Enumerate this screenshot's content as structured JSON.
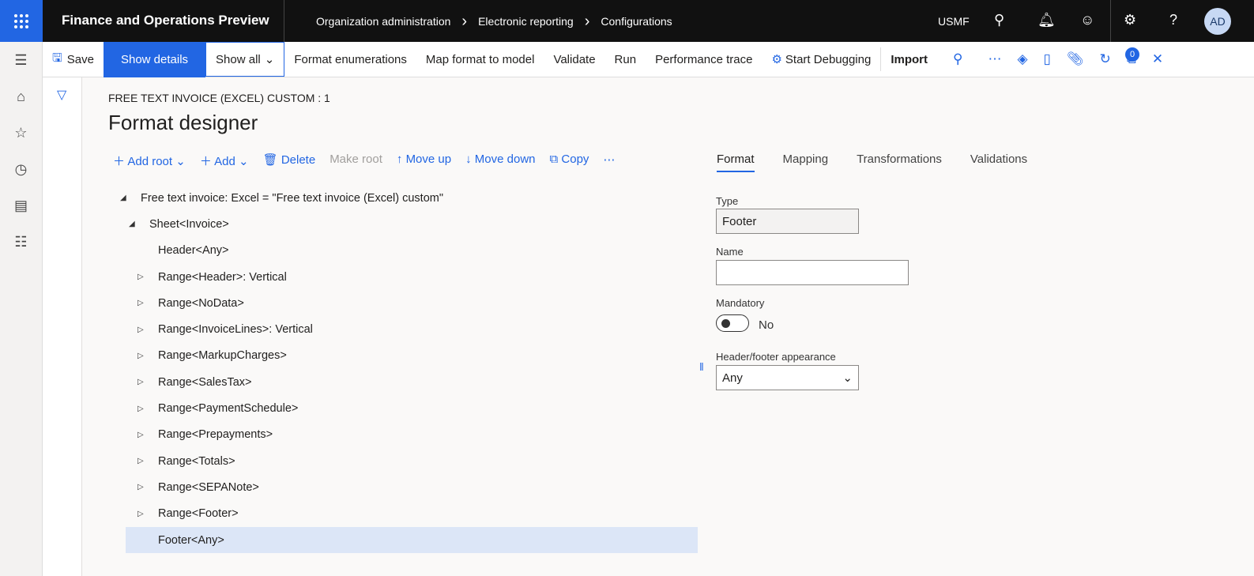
{
  "header": {
    "app_title": "Finance and Operations Preview",
    "breadcrumbs": [
      "Organization administration",
      "Electronic reporting",
      "Configurations"
    ],
    "company": "USMF",
    "avatar": "AD"
  },
  "toolbar": {
    "save": "Save",
    "show_details": "Show details",
    "show_all": "Show all",
    "format_enumerations": "Format enumerations",
    "map_format": "Map format to model",
    "validate": "Validate",
    "run": "Run",
    "performance_trace": "Performance trace",
    "start_debugging": "Start Debugging",
    "import": "Import",
    "attachments_count": "0"
  },
  "page": {
    "caption": "FREE TEXT INVOICE (EXCEL) CUSTOM : 1",
    "title": "Format designer"
  },
  "actions": {
    "add_root": "Add root",
    "add": "Add",
    "delete": "Delete",
    "make_root": "Make root",
    "move_up": "Move up",
    "move_down": "Move down",
    "copy": "Copy"
  },
  "tree": [
    {
      "label": "Free text invoice: Excel = \"Free text invoice (Excel) custom\"",
      "level": 0,
      "expander": "expanded"
    },
    {
      "label": "Sheet<Invoice>",
      "level": 1,
      "expander": "expanded"
    },
    {
      "label": "Header<Any>",
      "level": 2,
      "expander": "none"
    },
    {
      "label": "Range<Header>: Vertical",
      "level": 2,
      "expander": "collapsed"
    },
    {
      "label": "Range<NoData>",
      "level": 2,
      "expander": "collapsed"
    },
    {
      "label": "Range<InvoiceLines>: Vertical",
      "level": 2,
      "expander": "collapsed"
    },
    {
      "label": "Range<MarkupCharges>",
      "level": 2,
      "expander": "collapsed"
    },
    {
      "label": "Range<SalesTax>",
      "level": 2,
      "expander": "collapsed"
    },
    {
      "label": "Range<PaymentSchedule>",
      "level": 2,
      "expander": "collapsed"
    },
    {
      "label": "Range<Prepayments>",
      "level": 2,
      "expander": "collapsed"
    },
    {
      "label": "Range<Totals>",
      "level": 2,
      "expander": "collapsed"
    },
    {
      "label": "Range<SEPANote>",
      "level": 2,
      "expander": "collapsed"
    },
    {
      "label": "Range<Footer>",
      "level": 2,
      "expander": "collapsed"
    },
    {
      "label": "Footer<Any>",
      "level": 2,
      "expander": "none",
      "selected": true
    }
  ],
  "tabs": [
    "Format",
    "Mapping",
    "Transformations",
    "Validations"
  ],
  "details": {
    "type_label": "Type",
    "type_value": "Footer",
    "name_label": "Name",
    "name_value": "",
    "mandatory_label": "Mandatory",
    "mandatory_value": "No",
    "appearance_label": "Header/footer appearance",
    "appearance_value": "Any"
  }
}
